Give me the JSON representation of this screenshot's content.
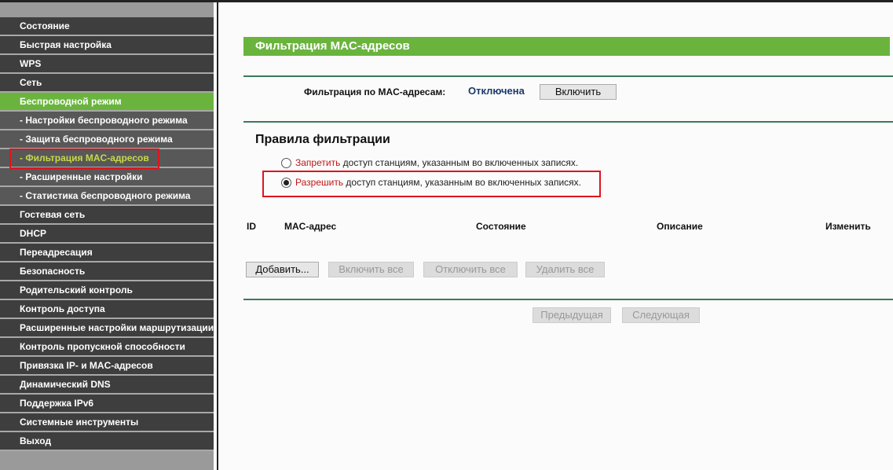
{
  "sidebar": {
    "items": [
      {
        "label": "Состояние",
        "type": "main"
      },
      {
        "label": "Быстрая настройка",
        "type": "main"
      },
      {
        "label": "WPS",
        "type": "main"
      },
      {
        "label": "Сеть",
        "type": "main"
      },
      {
        "label": "Беспроводной режим",
        "type": "active"
      },
      {
        "label": "- Настройки беспроводного режима",
        "type": "sub"
      },
      {
        "label": "- Защита беспроводного режима",
        "type": "sub"
      },
      {
        "label": "- Фильтрация MAC-адресов",
        "type": "cur"
      },
      {
        "label": "- Расширенные настройки",
        "type": "sub"
      },
      {
        "label": "- Статистика беспроводного режима",
        "type": "sub"
      },
      {
        "label": "Гостевая сеть",
        "type": "main"
      },
      {
        "label": "DHCP",
        "type": "main"
      },
      {
        "label": "Переадресация",
        "type": "main"
      },
      {
        "label": "Безопасность",
        "type": "main"
      },
      {
        "label": "Родительский контроль",
        "type": "main"
      },
      {
        "label": "Контроль доступа",
        "type": "main"
      },
      {
        "label": "Расширенные настройки маршрутизации",
        "type": "main"
      },
      {
        "label": "Контроль пропускной способности",
        "type": "main"
      },
      {
        "label": "Привязка IP- и MAC-адресов",
        "type": "main"
      },
      {
        "label": "Динамический DNS",
        "type": "main"
      },
      {
        "label": "Поддержка IPv6",
        "type": "main"
      },
      {
        "label": "Системные инструменты",
        "type": "main"
      },
      {
        "label": "Выход",
        "type": "main"
      }
    ]
  },
  "main": {
    "title": "Фильтрация MAC-адресов",
    "filter_label": "Фильтрация по MAC-адресам:",
    "filter_status": "Отключена",
    "enable_button": "Включить",
    "rules_title": "Правила фильтрации",
    "rule_deny_word": "Запретить",
    "rule_allow_word": "Разрешить",
    "rule_suffix": " доступ станциям, указанным во включенных записях.",
    "rule_selected": "allow",
    "table_headers": [
      "ID",
      "MAC-адрес",
      "Состояние",
      "Описание",
      "Изменить"
    ],
    "buttons": {
      "add": "Добавить...",
      "enable_all": "Включить все",
      "disable_all": "Отключить все",
      "delete_all": "Удалить все"
    },
    "pager": {
      "prev": "Предыдущая",
      "next": "Следующая"
    }
  },
  "colors": {
    "accent": "#6ab43e",
    "highlight": "#e0141e"
  }
}
